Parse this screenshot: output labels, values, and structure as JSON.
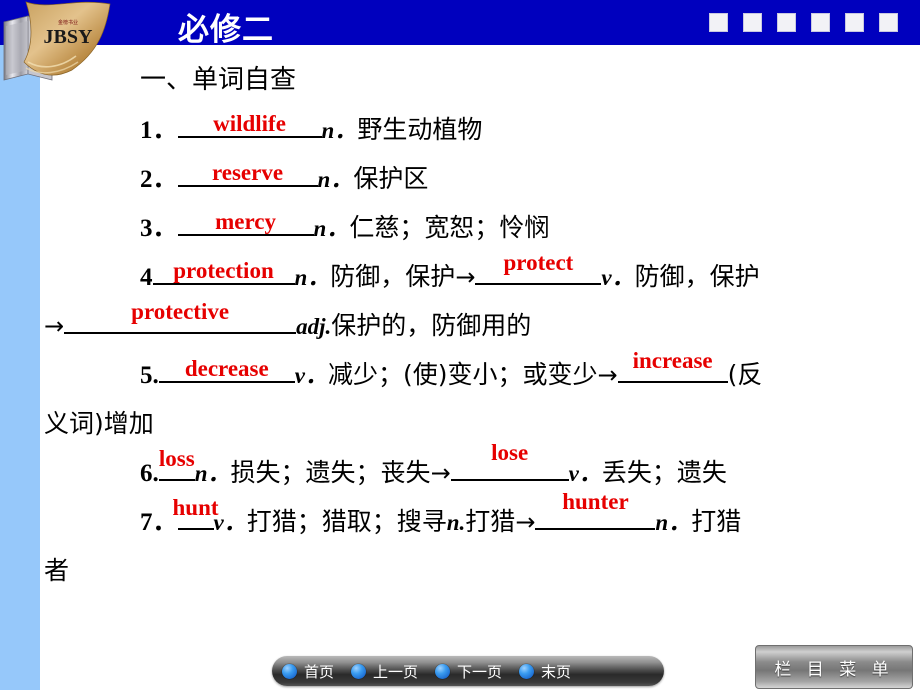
{
  "header": {
    "title": "必修二",
    "logo_text": "JBSY",
    "logo_subtext": "金榜书业",
    "square_count": 6,
    "bar_color": "#0000BE"
  },
  "sidebar": {
    "strip_color": "#96C8FA"
  },
  "content": {
    "heading": "一、单词自查",
    "answer_color": "#E60000",
    "entries": [
      {
        "num": "1．",
        "answer": "wildlife",
        "pos": "n．",
        "meaning": "野生动植物"
      },
      {
        "num": "2．",
        "answer": "reserve",
        "pos": "n．",
        "meaning": "保护区"
      },
      {
        "num": "3．",
        "answer": "mercy",
        "pos": "n．",
        "meaning": "仁慈；宽恕；怜悯"
      },
      {
        "num": "4",
        "answer": "protection",
        "pos": "n．",
        "meaning": "防御，保护",
        "arrow": "→",
        "answer2": "protect",
        "pos2": "v．",
        "meaning2": "防御，保护",
        "arrow2": "→",
        "answer3": "protective",
        "pos3": "adj.",
        "meaning3": "保护的，防御用的"
      },
      {
        "num": "5.",
        "answer": "decrease",
        "pos": "v．",
        "meaning": "减少；(使)变小；或变少",
        "arrow": "→",
        "answer2": "increase",
        "meaning2": "(反义词)增加"
      },
      {
        "num": "6.",
        "answer": "loss",
        "pos": "n．",
        "meaning": "损失；遗失；丧失",
        "arrow": "→",
        "answer2": "lose",
        "pos2": "v．",
        "meaning2": "丢失；遗失"
      },
      {
        "num": "7．",
        "answer": "hunt",
        "pos": "v．",
        "meaning": "打猎；猎取；搜寻",
        "pos_inline": "n.",
        "meaning_inline": "打猎",
        "arrow": "→",
        "answer2": "hunter",
        "pos2": "n．",
        "meaning2": "打猎者"
      }
    ],
    "wrap_fragments": {
      "line4_tail": "→",
      "line5_tail": "义词)增加",
      "line7_tail": "者"
    }
  },
  "footer": {
    "nav_items": [
      {
        "label": "首页",
        "icon": "blue-dot-icon"
      },
      {
        "label": "上一页",
        "icon": "blue-dot-icon"
      },
      {
        "label": "下一页",
        "icon": "blue-dot-icon"
      },
      {
        "label": "末页",
        "icon": "blue-dot-icon"
      }
    ],
    "menu_button": "栏 目 菜 单"
  }
}
